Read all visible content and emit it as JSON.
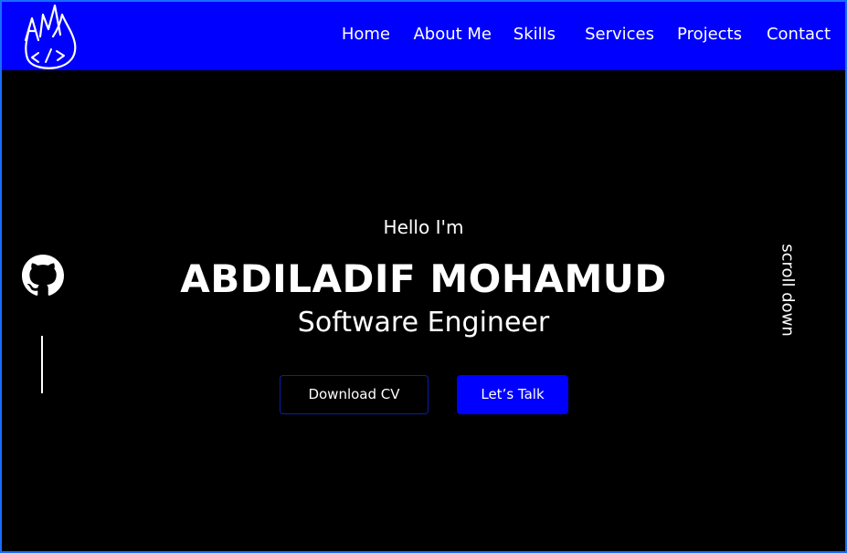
{
  "colors": {
    "accent": "#0000ff",
    "background": "#000000",
    "text": "#ffffff",
    "frame_border": "#1a6cff"
  },
  "header": {
    "logo": {
      "icon": "am-code-logo-icon"
    },
    "nav": [
      {
        "label": "Home"
      },
      {
        "label": "About Me"
      },
      {
        "label": "Skills"
      },
      {
        "label": "Services"
      },
      {
        "label": "Projects"
      },
      {
        "label": "Contact"
      }
    ]
  },
  "hero": {
    "greeting": "Hello I'm",
    "name": "ABDILADIF MOHAMUD",
    "role": "Software Engineer",
    "buttons": {
      "download_cv": "Download CV",
      "lets_talk": "Let’s Talk"
    }
  },
  "social": {
    "github_icon": "github-icon"
  },
  "scroll": {
    "label": "scroll down"
  }
}
